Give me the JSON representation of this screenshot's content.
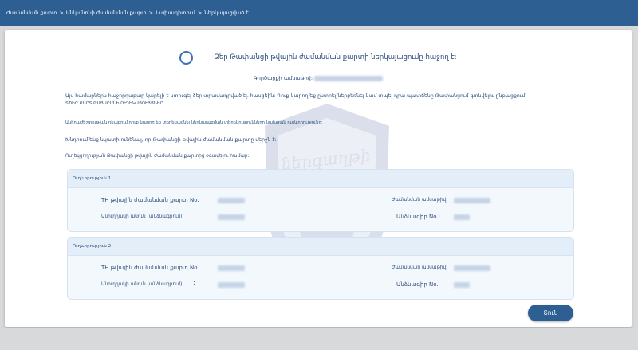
{
  "breadcrumb": {
    "items": [
      "Ժամանման քարտ",
      "Անկանոնի ժամանման քարտ",
      "Նախադիտում",
      "Ներկայացված է"
    ]
  },
  "success": {
    "title": "Ձեր Թափանցի թվային ժամանման քարտի ներկայացումը հաջող է:"
  },
  "order": {
    "label": "Գործարքի ամսաթիվ"
  },
  "info": {
    "line1": "Այս համարներն հաջորդաբար կարելի է ստուգել ձեր տրամադրված էլ. հասցեին: Դուք կարող եք ընտրել ներբեռնել կամ տպել դրա պատճենը Թափանցում գտնվելու ընթացքում:",
    "line1b": "ՏՊԵՐ ՔԱՐՏ ԹԱՑԱՐԱՆԻ ՈՒՂԵԿԱՑՈՒՅՑՆԵՐ",
    "line2": "Անհրաժեշտության դեպքում դուք կարող եք տեղեկացնել ներկայացման տեղեկությունները նախքան ուղևորությունը:",
    "line3": "Խնդրում ենք նկատի ունենալ, որ Թափանցի թվային ժամանման քարտը վերջն է:",
    "line4": "Ուղեկցողության Թափանցի թվային ժամանման քարտից օգտվելու համար:"
  },
  "watermark": {
    "text": "ներգաղթի բյուրո"
  },
  "travelers": [
    {
      "header": "Ուղևորություն 1",
      "card_label": "TH թվային ժամանման քարտ No.",
      "date_label": "Ժամանման ամսաթիվ:",
      "name_label": "Անուղղակի անուն (անձնագրում)",
      "passport_label": "Անձնագիր No.:"
    },
    {
      "header": "Ուղևորություն 2",
      "card_label": "TH թվային ժամանման քարտ No.",
      "date_label": "Ժամանման ամսաթիվ:",
      "name_label": "Անուղղակի անուն (անձնագրում)",
      "passport_label": "Անձնագիր No."
    }
  ],
  "actions": {
    "next_label": "Տուն"
  },
  "colors": {
    "header_bg": "#2d5f93",
    "accent": "#3b72b5",
    "text": "#2a4d7a"
  }
}
